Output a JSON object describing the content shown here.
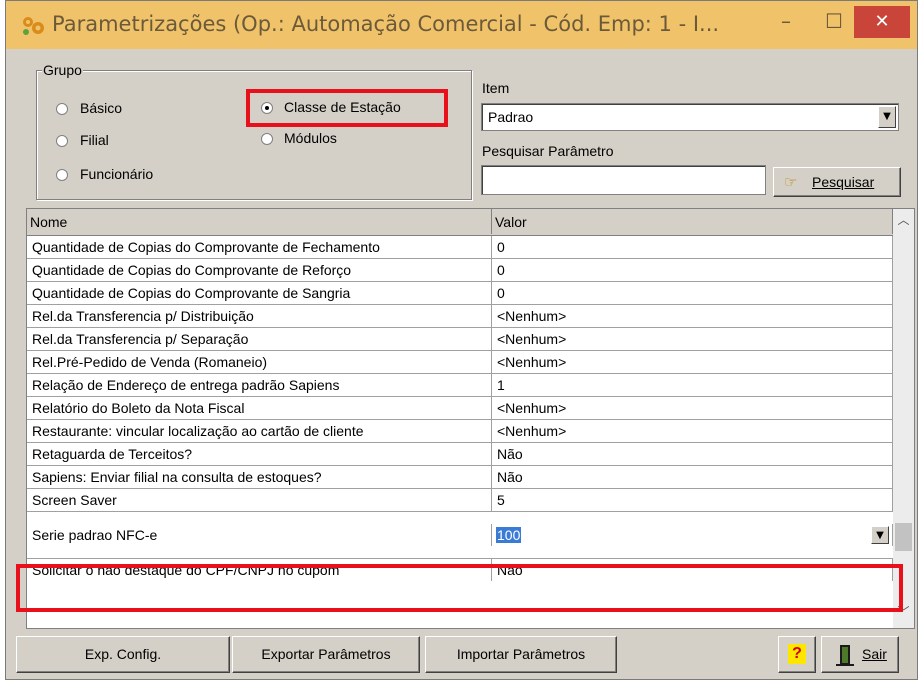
{
  "window": {
    "title": "Parametrizações (Op.: Automação Comercial - Cód. Emp: 1 - I...",
    "minimize": "–",
    "maximize": "☐",
    "close": "✕"
  },
  "group": {
    "title": "Grupo",
    "options": [
      "Básico",
      "Filial",
      "Funcionário",
      "Classe de Estação",
      "Módulos"
    ],
    "selected": "Classe de Estação"
  },
  "item": {
    "label": "Item",
    "value": "Padrao"
  },
  "search": {
    "label": "Pesquisar Parâmetro",
    "value": "",
    "button": "Pesquisar"
  },
  "grid": {
    "headers": [
      "Nome",
      "Valor"
    ],
    "rows": [
      [
        "Quantidade de Copias do Comprovante de Fechamento",
        "0"
      ],
      [
        "Quantidade de Copias do Comprovante de Reforço",
        "0"
      ],
      [
        "Quantidade de Copias do Comprovante de Sangria",
        "0"
      ],
      [
        "Rel.da Transferencia p/ Distribuição",
        "<Nenhum>"
      ],
      [
        "Rel.da Transferencia p/ Separação",
        "<Nenhum>"
      ],
      [
        "Rel.Pré-Pedido de Venda (Romaneio)",
        "<Nenhum>"
      ],
      [
        "Relação de Endereço de entrega padrão Sapiens",
        "1"
      ],
      [
        "Relatório do Boleto da Nota Fiscal",
        "<Nenhum>"
      ],
      [
        "Restaurante: vincular localização ao cartão de cliente",
        "<Nenhum>"
      ],
      [
        "Retaguarda de Terceitos?",
        "Não"
      ],
      [
        "Sapiens: Enviar filial na consulta de estoques?",
        "Não"
      ],
      [
        "Screen Saver",
        "5"
      ],
      [
        "Serie padrao NFC-e",
        "100"
      ],
      [
        "Solicitar o não destaque do CPF/CNPJ no cupom",
        "Não"
      ]
    ]
  },
  "buttons": {
    "exp_config": "Exp. Config.",
    "exportar": "Exportar Parâmetros",
    "importar": "Importar Parâmetros",
    "help": "?",
    "sair": "Sair"
  },
  "colors": {
    "titlebar": "#f0c36a",
    "highlight": "#e8101b",
    "selection": "#3a7bd5"
  }
}
